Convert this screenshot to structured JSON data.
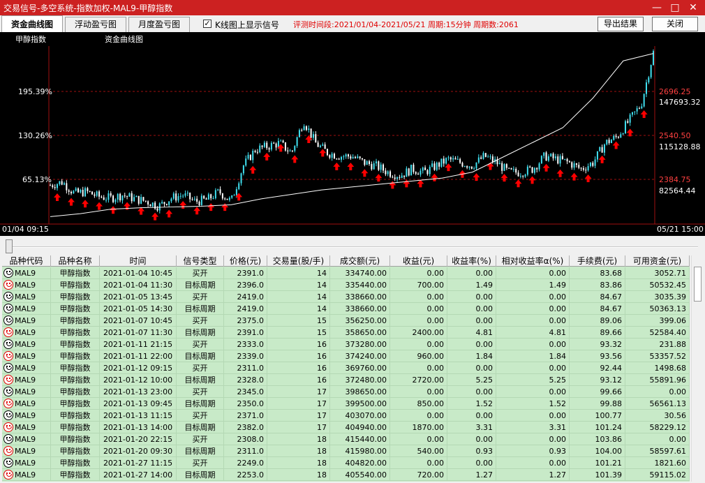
{
  "window": {
    "title": "交易信号-多空系统-指数加权-MAL9-甲醇指数",
    "min": "—",
    "max": "□",
    "close": "✕"
  },
  "tabs": [
    "资金曲线图",
    "浮动盈亏图",
    "月度盈亏图"
  ],
  "checkbox": {
    "label": "K线图上显示信号",
    "checked": true,
    "mark": "✓"
  },
  "info": "评测时间段:2021/01/04-2021/05/21 周期:15分钟 周期数:2061",
  "buttons": {
    "export": "导出结果",
    "close": "关闭"
  },
  "chart": {
    "name_label": "甲醇指数",
    "curve_label": "资金曲线图",
    "left_ticks": [
      "195.39%",
      "130.26%",
      "65.13%"
    ],
    "right_price_ticks": [
      "2696.25",
      "2540.50",
      "2384.75"
    ],
    "right_fund_ticks": [
      "147693.32",
      "115128.88",
      "82564.44"
    ],
    "start_time": "01/04 09:15",
    "end_time": "05/21 15:00",
    "colors": {
      "bg": "#000000",
      "up": "#40e0f0",
      "down": "#ffffff",
      "grid": "#a01010",
      "signal": "#ff0000",
      "curve": "#ffffff",
      "price_tick": "#ff4040"
    }
  },
  "chart_data": {
    "type": "line",
    "price_x_fraction": [
      0,
      0.02,
      0.04,
      0.06,
      0.08,
      0.1,
      0.12,
      0.14,
      0.16,
      0.18,
      0.2,
      0.22,
      0.24,
      0.26,
      0.28,
      0.3,
      0.32,
      0.34,
      0.36,
      0.38,
      0.4,
      0.42,
      0.44,
      0.46,
      0.48,
      0.5,
      0.52,
      0.54,
      0.56,
      0.58,
      0.6,
      0.62,
      0.64,
      0.66,
      0.68,
      0.7,
      0.72,
      0.74,
      0.76,
      0.78,
      0.8,
      0.82,
      0.84,
      0.86,
      0.88,
      0.9,
      0.92,
      0.94,
      0.96,
      0.98,
      1
    ],
    "price": [
      2350,
      2360,
      2325,
      2330,
      2315,
      2310,
      2320,
      2308,
      2300,
      2285,
      2310,
      2320,
      2300,
      2305,
      2330,
      2300,
      2410,
      2460,
      2470,
      2480,
      2450,
      2550,
      2480,
      2450,
      2440,
      2440,
      2420,
      2410,
      2390,
      2380,
      2400,
      2390,
      2410,
      2430,
      2420,
      2410,
      2440,
      2420,
      2390,
      2390,
      2400,
      2440,
      2430,
      2420,
      2400,
      2420,
      2480,
      2500,
      2550,
      2600,
      2760
    ],
    "fund_x_fraction": [
      0,
      0.05,
      0.1,
      0.15,
      0.2,
      0.25,
      0.3,
      0.35,
      0.4,
      0.45,
      0.5,
      0.55,
      0.6,
      0.65,
      0.7,
      0.75,
      0.8,
      0.85,
      0.9,
      0.95,
      1
    ],
    "fund": [
      50000,
      52000,
      55000,
      56000,
      56500,
      57000,
      58000,
      62000,
      65000,
      68000,
      70000,
      72000,
      74000,
      76000,
      80000,
      90000,
      100000,
      110000,
      130000,
      155000,
      160000
    ]
  },
  "table": {
    "headers": [
      "品种代码",
      "品种名称",
      "时间",
      "信号类型",
      "价格(元)",
      "交易量(股/手)",
      "成交额(元)",
      "收益(元)",
      "收益率(%)",
      "相对收益率α(%)",
      "手续费(元)",
      "可用资金(元)"
    ],
    "rows": [
      {
        "red": false,
        "code": "MAL9",
        "name": "甲醇指数",
        "time": "2021-01-04 10:45",
        "type": "买开",
        "price": "2391.0",
        "vol": "14",
        "amount": "334740.00",
        "profit": "0.00",
        "rate": "0.00",
        "alpha": "0.00",
        "fee": "83.68",
        "fund": "3052.71"
      },
      {
        "red": true,
        "code": "MAL9",
        "name": "甲醇指数",
        "time": "2021-01-04 11:30",
        "type": "目标周期",
        "price": "2396.0",
        "vol": "14",
        "amount": "335440.00",
        "profit": "700.00",
        "rate": "1.49",
        "alpha": "1.49",
        "fee": "83.86",
        "fund": "50532.45"
      },
      {
        "red": false,
        "code": "MAL9",
        "name": "甲醇指数",
        "time": "2021-01-05 13:45",
        "type": "买开",
        "price": "2419.0",
        "vol": "14",
        "amount": "338660.00",
        "profit": "0.00",
        "rate": "0.00",
        "alpha": "0.00",
        "fee": "84.67",
        "fund": "3035.39"
      },
      {
        "red": false,
        "code": "MAL9",
        "name": "甲醇指数",
        "time": "2021-01-05 14:30",
        "type": "目标周期",
        "price": "2419.0",
        "vol": "14",
        "amount": "338660.00",
        "profit": "0.00",
        "rate": "0.00",
        "alpha": "0.00",
        "fee": "84.67",
        "fund": "50363.13"
      },
      {
        "red": false,
        "code": "MAL9",
        "name": "甲醇指数",
        "time": "2021-01-07 10:45",
        "type": "买开",
        "price": "2375.0",
        "vol": "15",
        "amount": "356250.00",
        "profit": "0.00",
        "rate": "0.00",
        "alpha": "0.00",
        "fee": "89.06",
        "fund": "399.06"
      },
      {
        "red": true,
        "code": "MAL9",
        "name": "甲醇指数",
        "time": "2021-01-07 11:30",
        "type": "目标周期",
        "price": "2391.0",
        "vol": "15",
        "amount": "358650.00",
        "profit": "2400.00",
        "rate": "4.81",
        "alpha": "4.81",
        "fee": "89.66",
        "fund": "52584.40"
      },
      {
        "red": false,
        "code": "MAL9",
        "name": "甲醇指数",
        "time": "2021-01-11 21:15",
        "type": "买开",
        "price": "2333.0",
        "vol": "16",
        "amount": "373280.00",
        "profit": "0.00",
        "rate": "0.00",
        "alpha": "0.00",
        "fee": "93.32",
        "fund": "231.88"
      },
      {
        "red": true,
        "code": "MAL9",
        "name": "甲醇指数",
        "time": "2021-01-11 22:00",
        "type": "目标周期",
        "price": "2339.0",
        "vol": "16",
        "amount": "374240.00",
        "profit": "960.00",
        "rate": "1.84",
        "alpha": "1.84",
        "fee": "93.56",
        "fund": "53357.52"
      },
      {
        "red": false,
        "code": "MAL9",
        "name": "甲醇指数",
        "time": "2021-01-12 09:15",
        "type": "买开",
        "price": "2311.0",
        "vol": "16",
        "amount": "369760.00",
        "profit": "0.00",
        "rate": "0.00",
        "alpha": "0.00",
        "fee": "92.44",
        "fund": "1498.68"
      },
      {
        "red": true,
        "code": "MAL9",
        "name": "甲醇指数",
        "time": "2021-01-12 10:00",
        "type": "目标周期",
        "price": "2328.0",
        "vol": "16",
        "amount": "372480.00",
        "profit": "2720.00",
        "rate": "5.25",
        "alpha": "5.25",
        "fee": "93.12",
        "fund": "55891.96"
      },
      {
        "red": false,
        "code": "MAL9",
        "name": "甲醇指数",
        "time": "2021-01-13 23:00",
        "type": "买开",
        "price": "2345.0",
        "vol": "17",
        "amount": "398650.00",
        "profit": "0.00",
        "rate": "0.00",
        "alpha": "0.00",
        "fee": "99.66",
        "fund": "0.00"
      },
      {
        "red": true,
        "code": "MAL9",
        "name": "甲醇指数",
        "time": "2021-01-13 09:45",
        "type": "目标周期",
        "price": "2350.0",
        "vol": "17",
        "amount": "399500.00",
        "profit": "850.00",
        "rate": "1.52",
        "alpha": "1.52",
        "fee": "99.88",
        "fund": "56561.13"
      },
      {
        "red": false,
        "code": "MAL9",
        "name": "甲醇指数",
        "time": "2021-01-13 11:15",
        "type": "买开",
        "price": "2371.0",
        "vol": "17",
        "amount": "403070.00",
        "profit": "0.00",
        "rate": "0.00",
        "alpha": "0.00",
        "fee": "100.77",
        "fund": "30.56"
      },
      {
        "red": true,
        "code": "MAL9",
        "name": "甲醇指数",
        "time": "2021-01-13 14:00",
        "type": "目标周期",
        "price": "2382.0",
        "vol": "17",
        "amount": "404940.00",
        "profit": "1870.00",
        "rate": "3.31",
        "alpha": "3.31",
        "fee": "101.24",
        "fund": "58229.12"
      },
      {
        "red": false,
        "code": "MAL9",
        "name": "甲醇指数",
        "time": "2021-01-20 22:15",
        "type": "买开",
        "price": "2308.0",
        "vol": "18",
        "amount": "415440.00",
        "profit": "0.00",
        "rate": "0.00",
        "alpha": "0.00",
        "fee": "103.86",
        "fund": "0.00"
      },
      {
        "red": true,
        "code": "MAL9",
        "name": "甲醇指数",
        "time": "2021-01-20 09:30",
        "type": "目标周期",
        "price": "2311.0",
        "vol": "18",
        "amount": "415980.00",
        "profit": "540.00",
        "rate": "0.93",
        "alpha": "0.93",
        "fee": "104.00",
        "fund": "58597.61"
      },
      {
        "red": false,
        "code": "MAL9",
        "name": "甲醇指数",
        "time": "2021-01-27 11:15",
        "type": "买开",
        "price": "2249.0",
        "vol": "18",
        "amount": "404820.00",
        "profit": "0.00",
        "rate": "0.00",
        "alpha": "0.00",
        "fee": "101.21",
        "fund": "1821.60"
      },
      {
        "red": true,
        "code": "MAL9",
        "name": "甲醇指数",
        "time": "2021-01-27 14:00",
        "type": "目标周期",
        "price": "2253.0",
        "vol": "18",
        "amount": "405540.00",
        "profit": "720.00",
        "rate": "1.27",
        "alpha": "1.27",
        "fee": "101.39",
        "fund": "59115.02"
      }
    ]
  }
}
